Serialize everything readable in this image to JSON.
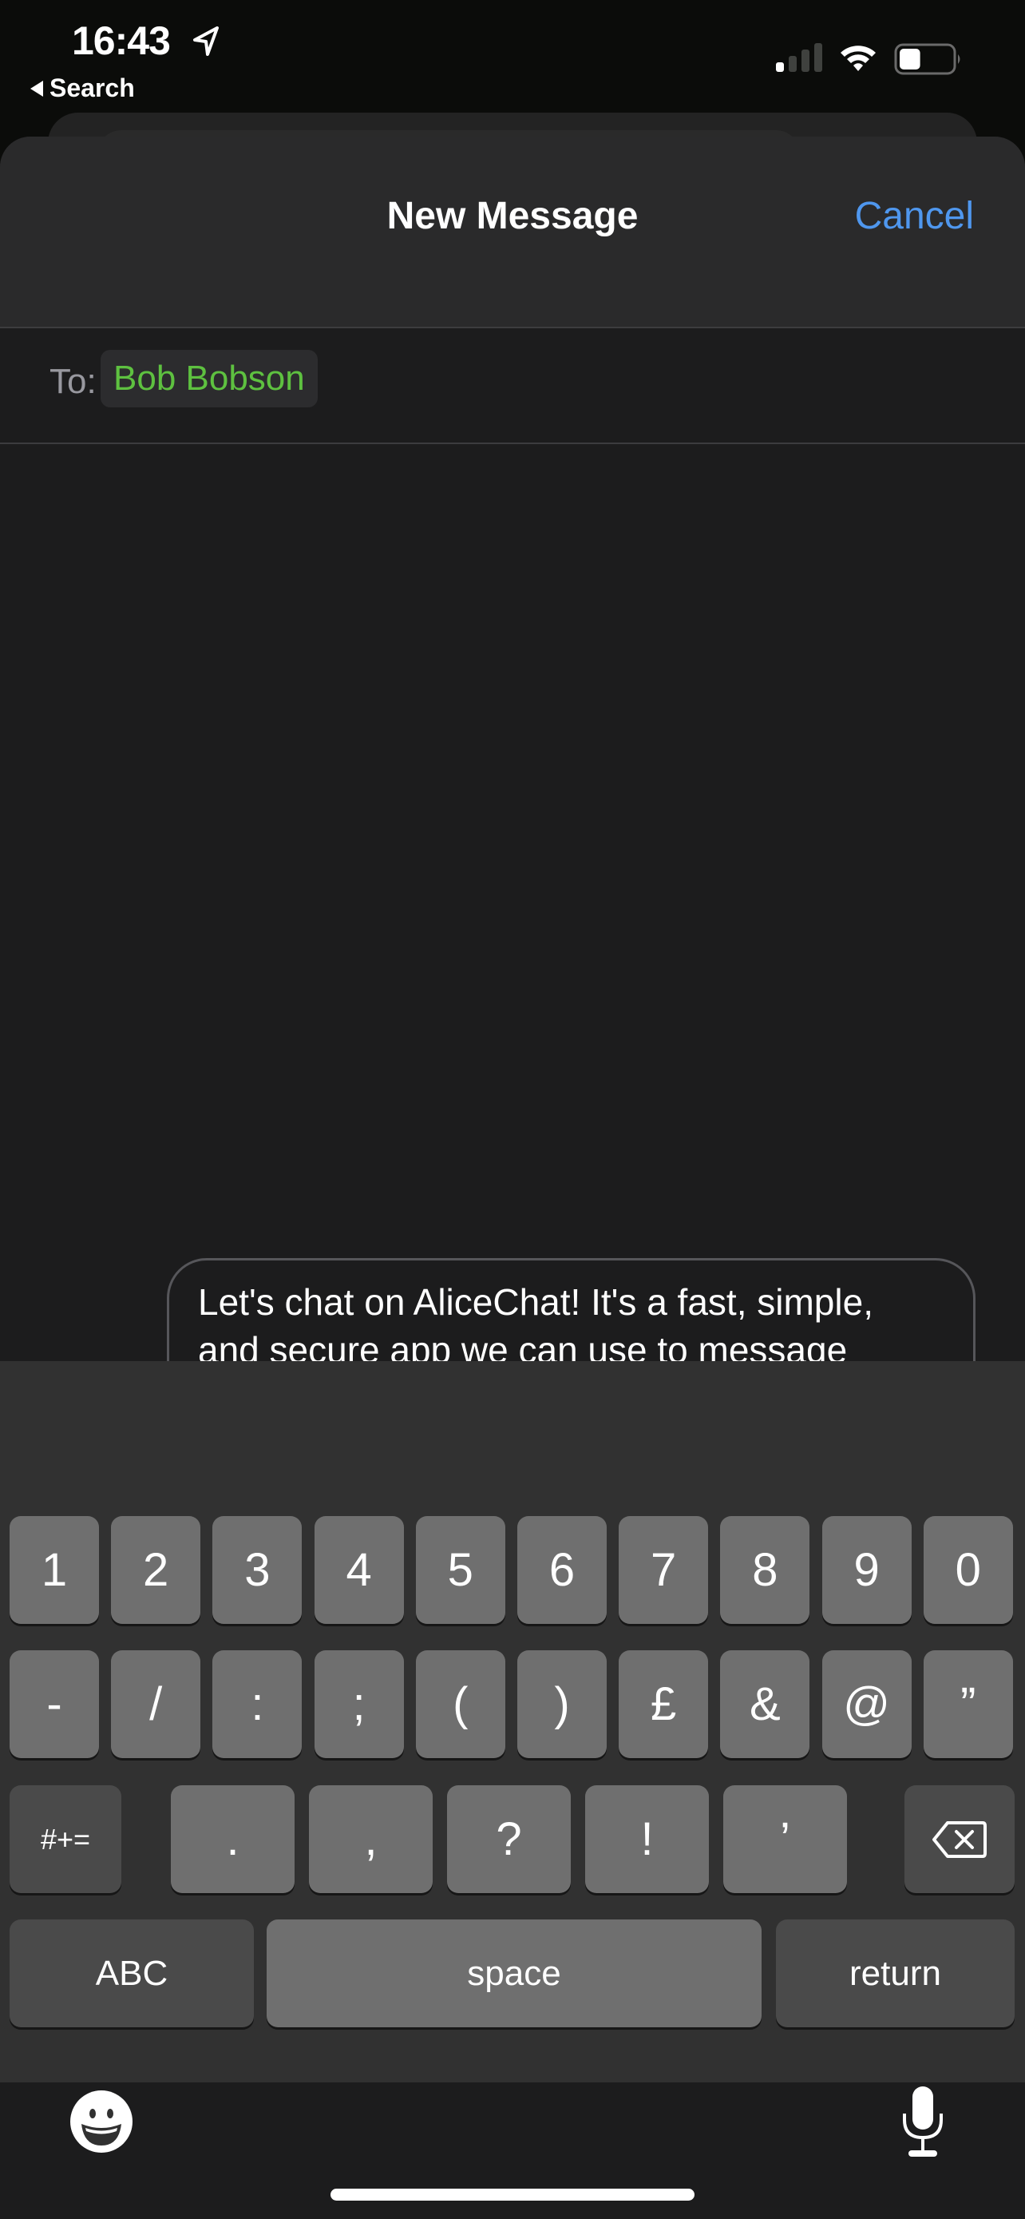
{
  "status_bar": {
    "time": "16:43",
    "back_label": "Search",
    "signal_bars_active": 1,
    "signal_bars_total": 4,
    "battery_level_percent": 40,
    "icons": [
      "location-arrow-icon",
      "signal-icon",
      "wifi-icon",
      "battery-icon"
    ]
  },
  "header": {
    "title": "New Message",
    "cancel_label": "Cancel"
  },
  "recipients": {
    "label": "To:",
    "contacts": [
      "Bob Bobson"
    ]
  },
  "compose": {
    "text": "Let's chat on AliceChat! It's a fast, simple, and secure app we can use to message and call each other for free. Get it at...",
    "expand_icon": "chevron-right-icon",
    "send_icon": "arrow-up-icon"
  },
  "keyboard": {
    "row1": [
      "1",
      "2",
      "3",
      "4",
      "5",
      "6",
      "7",
      "8",
      "9",
      "0"
    ],
    "row2": [
      "-",
      "/",
      ":",
      ";",
      "(",
      ")",
      "£",
      "&",
      "@",
      "”"
    ],
    "row3_mode": "#+=",
    "row3": [
      ".",
      ",",
      "?",
      "!",
      "’"
    ],
    "row4": {
      "abc": "ABC",
      "space": "space",
      "return": "return"
    },
    "delete_icon": "backspace-icon",
    "emoji_icon": "emoji-icon",
    "mic_icon": "microphone-icon"
  },
  "colors": {
    "accent_blue": "#4f97ee",
    "contact_green": "#5ec140",
    "send_green": "#5fc25e",
    "caret_blue": "#3b6cf0"
  }
}
